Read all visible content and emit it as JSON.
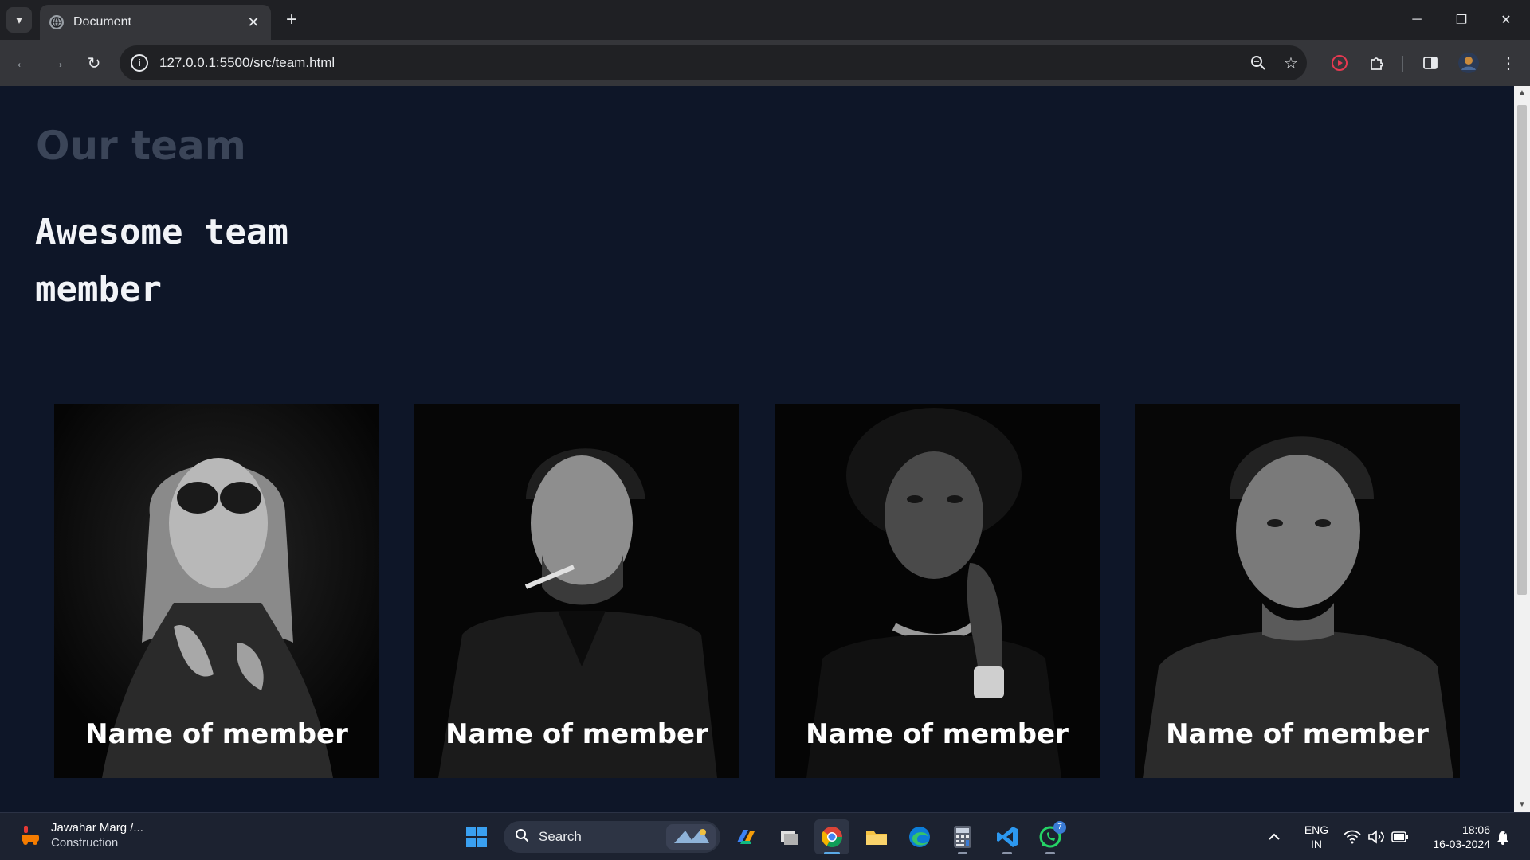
{
  "browser": {
    "tab_title": "Document",
    "url": "127.0.0.1:5500/src/team.html"
  },
  "page": {
    "title": "Our team",
    "subtitle": "Awesome team member",
    "members": [
      {
        "name": "Name of member"
      },
      {
        "name": "Name of member"
      },
      {
        "name": "Name of member"
      },
      {
        "name": "Name of member"
      }
    ]
  },
  "taskbar": {
    "weather": {
      "location": "Jawahar Marg /...",
      "status": "Construction"
    },
    "search_label": "Search",
    "whatsapp_badge": "7",
    "language": {
      "line1": "ENG",
      "line2": "IN"
    },
    "time": "18:06",
    "date": "16-03-2024"
  },
  "colors": {
    "page_background": "#0e1628",
    "title_color": "#3b4558",
    "subtitle_color": "#f2f4f8"
  }
}
